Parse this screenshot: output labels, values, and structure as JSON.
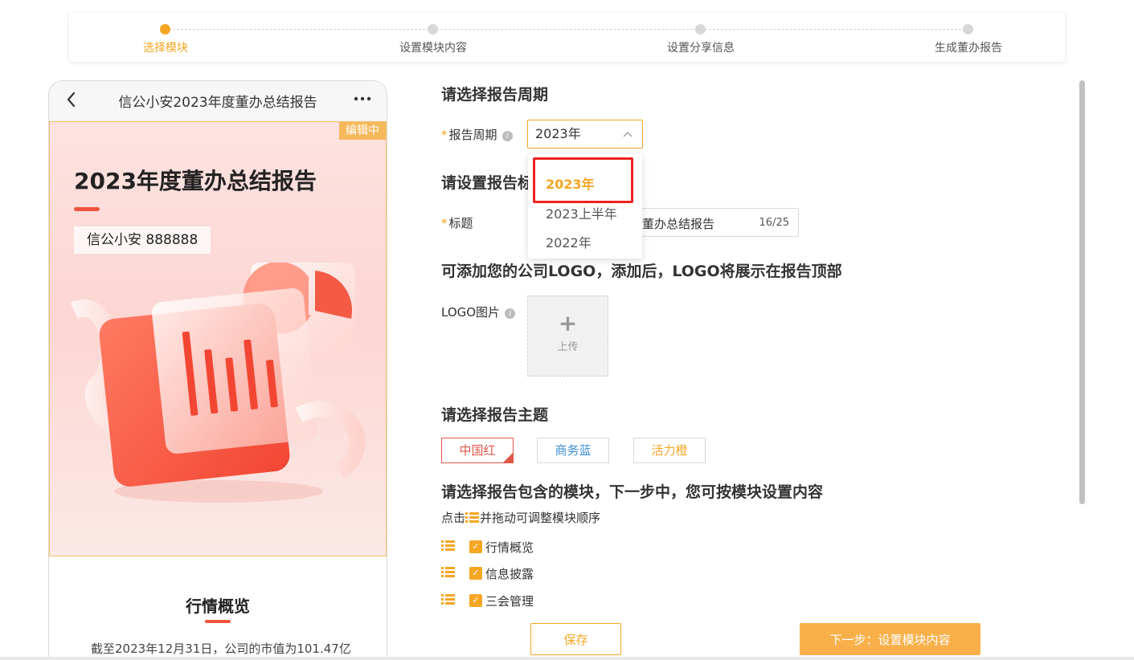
{
  "stepper": {
    "steps": [
      {
        "label": "选择模块",
        "active": true
      },
      {
        "label": "设置模块内容",
        "active": false
      },
      {
        "label": "设置分享信息",
        "active": false
      },
      {
        "label": "生成董办报告",
        "active": false
      }
    ]
  },
  "preview": {
    "header_title": "信公小安2023年度董办总结报告",
    "back_icon": "chevron-left-icon",
    "more_icon": "more-dots-icon",
    "editing_badge": "编辑中",
    "cover_title": "2023年度董办总结报告",
    "company": "信公小安   888888",
    "section_title": "行情概览",
    "section_text": "截至2023年12月31日，公司的市值为101.47亿"
  },
  "form": {
    "period_heading": "请选择报告周期",
    "period_label": "报告周期",
    "period_value": "2023年",
    "period_options": [
      "2023年",
      "2023上半年",
      "2022年"
    ],
    "period_selected": "2023年",
    "title_heading": "请设置报告标",
    "title_label": "标题",
    "title_value": "董办总结报告",
    "title_count": "16/25",
    "logo_heading": "可添加您的公司LOGO，添加后，LOGO将展示在报告顶部",
    "logo_label": "LOGO图片",
    "upload_text": "上传",
    "theme_heading": "请选择报告主题",
    "themes": [
      "中国红",
      "商务蓝",
      "活力橙"
    ],
    "modules_heading": "请选择报告包含的模块，下一步中，您可按模块设置内容",
    "modules_hint_prefix": "点击",
    "modules_hint_suffix": "并拖动可调整模块顺序",
    "modules": [
      {
        "label": "行情概览",
        "checked": true
      },
      {
        "label": "信息披露",
        "checked": true
      },
      {
        "label": "三会管理",
        "checked": true
      }
    ]
  },
  "actions": {
    "save": "保存",
    "next": "下一步：设置模块内容"
  },
  "colors": {
    "accent": "#f5a623",
    "red": "#e0574a",
    "blue": "#3c8fd6",
    "highlight": "#ee2222"
  }
}
